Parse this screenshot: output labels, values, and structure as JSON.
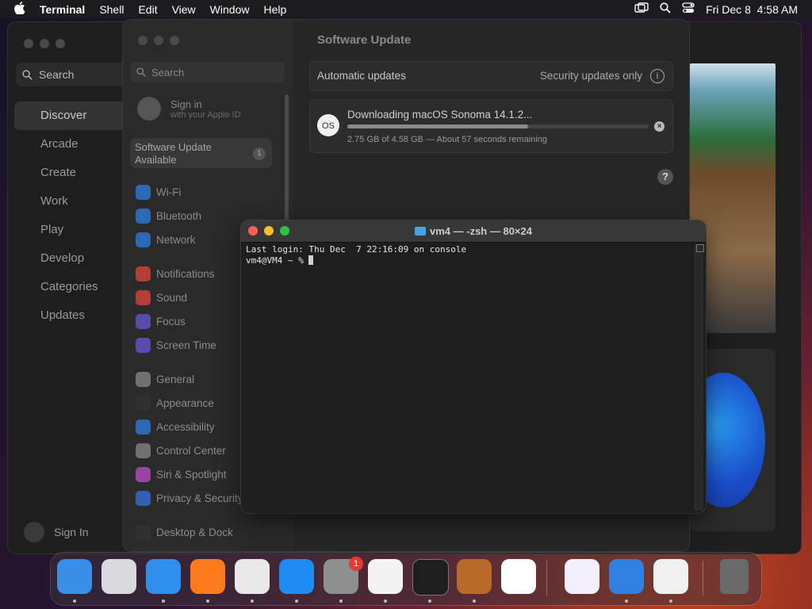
{
  "menubar": {
    "app": "Terminal",
    "items": [
      "Shell",
      "Edit",
      "View",
      "Window",
      "Help"
    ],
    "datetime": "Fri Dec 8  4:58 AM"
  },
  "appstore": {
    "search_placeholder": "Search",
    "nav": [
      "Discover",
      "Arcade",
      "Create",
      "Work",
      "Play",
      "Develop",
      "Categories",
      "Updates"
    ],
    "selected": "Discover",
    "sign_in": "Sign In"
  },
  "settings": {
    "search_placeholder": "Search",
    "sign_in": "Sign in",
    "sign_in_sub": "with your Apple ID",
    "update_available_line1": "Software Update",
    "update_available_line2": "Available",
    "update_badge": "1",
    "items": [
      {
        "label": "Wi-Fi",
        "color": "#2f7fe0"
      },
      {
        "label": "Bluetooth",
        "color": "#2f7fe0"
      },
      {
        "label": "Network",
        "color": "#2f7fe0"
      },
      {
        "label": "Notifications",
        "color": "#e0453a"
      },
      {
        "label": "Sound",
        "color": "#e0453a"
      },
      {
        "label": "Focus",
        "color": "#6a55d8"
      },
      {
        "label": "Screen Time",
        "color": "#6a55d8"
      },
      {
        "label": "General",
        "color": "#8a8a8a"
      },
      {
        "label": "Appearance",
        "color": "#333333"
      },
      {
        "label": "Accessibility",
        "color": "#2f7fe0"
      },
      {
        "label": "Control Center",
        "color": "#8a8a8a"
      },
      {
        "label": "Siri & Spotlight",
        "color": "#c04bd0"
      },
      {
        "label": "Privacy & Security",
        "color": "#3a6fe0"
      },
      {
        "label": "Desktop & Dock",
        "color": "#333333"
      }
    ],
    "page_title": "Software Update",
    "automatic_updates_label": "Automatic updates",
    "automatic_updates_value": "Security updates only",
    "download_title": "Downloading macOS Sonoma 14.1.2...",
    "download_status": "2.75 GB of 4.58 GB — About 57 seconds remaining",
    "download_progress": 0.6,
    "os_icon_text": "OS"
  },
  "terminal": {
    "title": "vm4 — -zsh — 80×24",
    "line1": "Last login: Thu Dec  7 22:16:09 on console",
    "prompt": "vm4@VM4 ~ % "
  },
  "dock": {
    "apps": [
      {
        "name": "finder",
        "color": "#3a8ee8"
      },
      {
        "name": "launchpad",
        "color": "#d9d9e0"
      },
      {
        "name": "safari",
        "color": "#2f8fea"
      },
      {
        "name": "firefox",
        "color": "#ff7a1a"
      },
      {
        "name": "chrome",
        "color": "#e9e9e9"
      },
      {
        "name": "app-store",
        "color": "#1f8cf3"
      },
      {
        "name": "system-settings",
        "color": "#8f8f8f"
      },
      {
        "name": "textedit",
        "color": "#f3f3f3"
      },
      {
        "name": "terminal",
        "color": "#1e1e1e"
      },
      {
        "name": "garageband",
        "color": "#b86a2a"
      },
      {
        "name": "vscode",
        "color": "#ffffff"
      },
      {
        "name": "visual-studio",
        "color": "#f4f0fb"
      },
      {
        "name": "weather",
        "color": "#2f80e0"
      },
      {
        "name": "archive-utility",
        "color": "#f0f0f0"
      },
      {
        "name": "trash",
        "color": "#6a6a6a"
      }
    ],
    "settings_badge": "1"
  }
}
